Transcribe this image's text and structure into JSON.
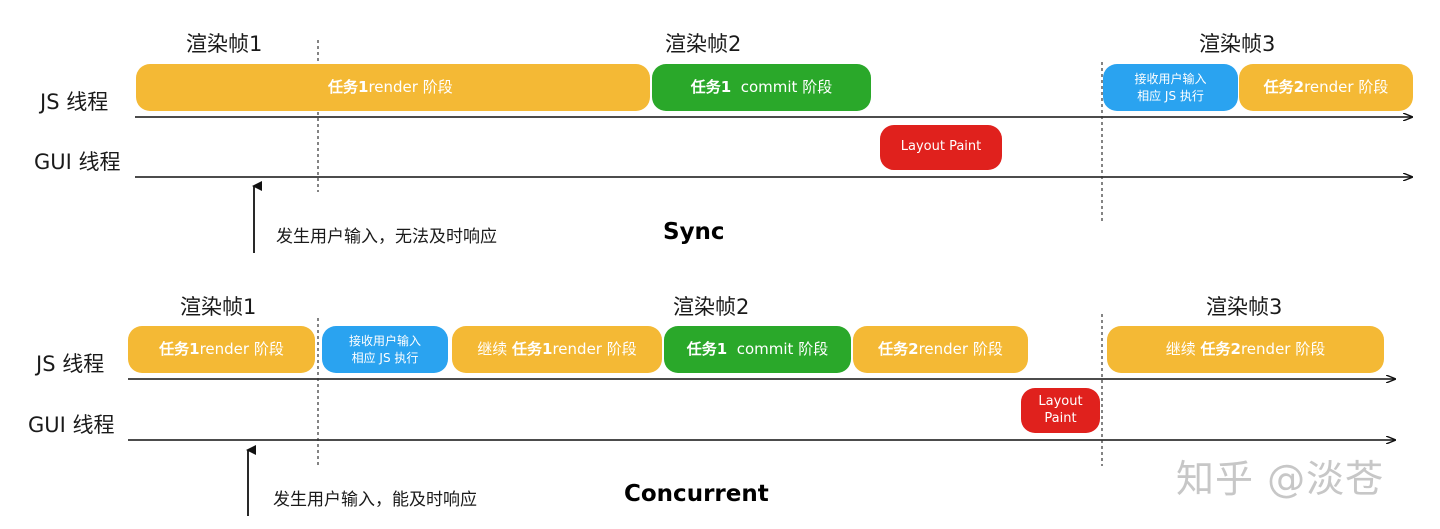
{
  "sync": {
    "frames": [
      "渲染帧1",
      "渲染帧2",
      "渲染帧3"
    ],
    "rows": {
      "js": "JS 线程",
      "gui": "GUI 线程"
    },
    "blocks": {
      "b1": {
        "bold": "任务1",
        "text": " render 阶段"
      },
      "b2": {
        "bold": "任务1",
        "text": "  commit 阶段"
      },
      "b3": {
        "line1": "接收用户输入",
        "line2": "相应 JS 执行"
      },
      "b4": {
        "bold": "任务2",
        "text": " render 阶段"
      },
      "layout": {
        "text": "Layout Paint"
      }
    },
    "caption": "发生用户输入，无法及时响应",
    "title": "Sync"
  },
  "concurrent": {
    "frames": [
      "渲染帧1",
      "渲染帧2",
      "渲染帧3"
    ],
    "rows": {
      "js": "JS 线程",
      "gui": "GUI 线程"
    },
    "blocks": {
      "b1": {
        "bold": "任务1",
        "text": " render 阶段"
      },
      "b2": {
        "line1": "接收用户输入",
        "line2": "相应 JS 执行"
      },
      "b3": {
        "prefix": "继续 ",
        "bold": "任务1",
        "text": " render 阶段"
      },
      "b4": {
        "bold": "任务1",
        "text": "  commit 阶段"
      },
      "b5": {
        "bold": "任务2",
        "text": " render 阶段"
      },
      "b6": {
        "prefix": "继续 ",
        "bold": "任务2",
        "text": " render 阶段"
      },
      "layout": {
        "line1": "Layout",
        "line2": "Paint"
      }
    },
    "caption": "发生用户输入，能及时响应",
    "title": "Concurrent"
  },
  "watermark": "知乎 @淡苍",
  "colors": {
    "render": "#f4b935",
    "commit": "#2aa82a",
    "input": "#2aa3f0",
    "layout": "#e0211d"
  }
}
